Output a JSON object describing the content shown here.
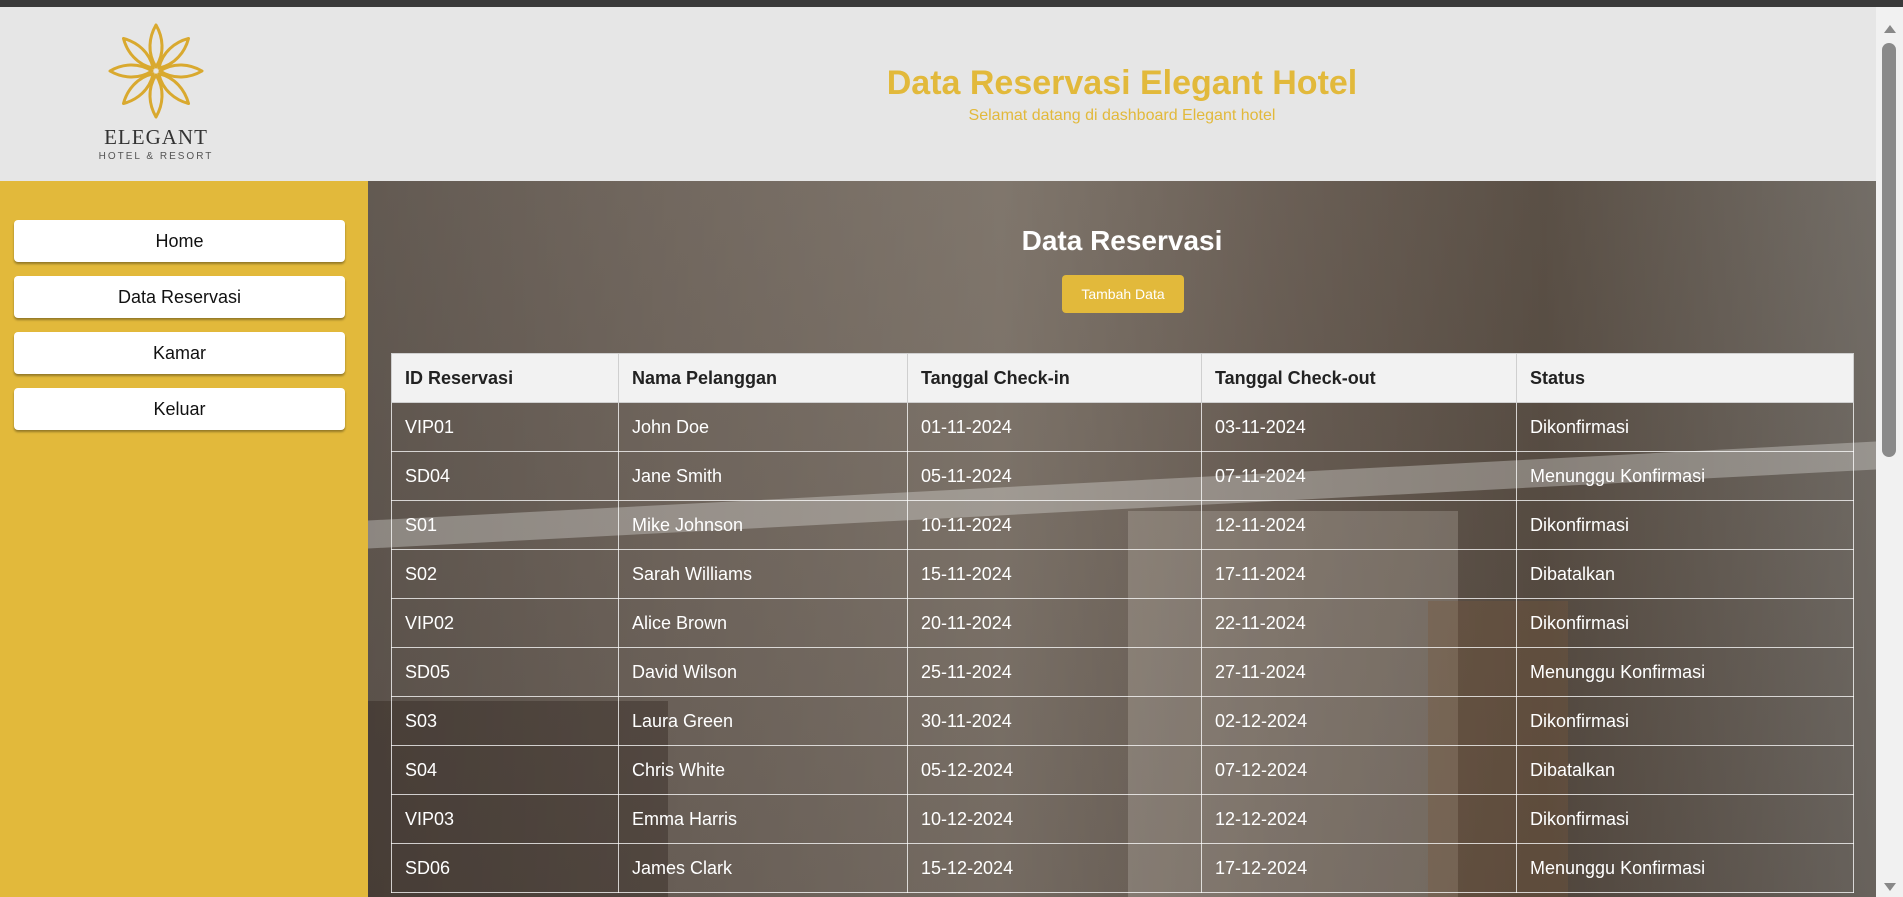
{
  "header": {
    "logo_name": "ELEGANT",
    "logo_sub": "HOTEL & RESORT",
    "title": "Data Reservasi Elegant Hotel",
    "subtitle": "Selamat datang di dashboard Elegant hotel"
  },
  "sidebar": {
    "items": [
      {
        "label": "Home"
      },
      {
        "label": "Data Reservasi"
      },
      {
        "label": "Kamar"
      },
      {
        "label": "Keluar"
      }
    ]
  },
  "main": {
    "title": "Data Reservasi",
    "add_button": "Tambah Data",
    "table": {
      "headers": [
        "ID Reservasi",
        "Nama Pelanggan",
        "Tanggal Check-in",
        "Tanggal Check-out",
        "Status"
      ],
      "rows": [
        [
          "VIP01",
          "John Doe",
          "01-11-2024",
          "03-11-2024",
          "Dikonfirmasi"
        ],
        [
          "SD04",
          "Jane Smith",
          "05-11-2024",
          "07-11-2024",
          "Menunggu Konfirmasi"
        ],
        [
          "S01",
          "Mike Johnson",
          "10-11-2024",
          "12-11-2024",
          "Dikonfirmasi"
        ],
        [
          "S02",
          "Sarah Williams",
          "15-11-2024",
          "17-11-2024",
          "Dibatalkan"
        ],
        [
          "VIP02",
          "Alice Brown",
          "20-11-2024",
          "22-11-2024",
          "Dikonfirmasi"
        ],
        [
          "SD05",
          "David Wilson",
          "25-11-2024",
          "27-11-2024",
          "Menunggu Konfirmasi"
        ],
        [
          "S03",
          "Laura Green",
          "30-11-2024",
          "02-12-2024",
          "Dikonfirmasi"
        ],
        [
          "S04",
          "Chris White",
          "05-12-2024",
          "07-12-2024",
          "Dibatalkan"
        ],
        [
          "VIP03",
          "Emma Harris",
          "10-12-2024",
          "12-12-2024",
          "Dikonfirmasi"
        ],
        [
          "SD06",
          "James Clark",
          "15-12-2024",
          "17-12-2024",
          "Menunggu Konfirmasi"
        ]
      ]
    }
  },
  "colors": {
    "accent": "#e2b93b",
    "header_bg": "#e6e6e6",
    "table_header_bg": "#f2f2f2"
  }
}
